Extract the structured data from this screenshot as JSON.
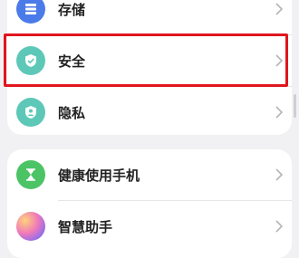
{
  "settings_group_1": {
    "items": [
      {
        "label": "存储",
        "icon": "storage-icon",
        "color": "#4a7be8"
      },
      {
        "label": "安全",
        "icon": "shield-icon",
        "color": "#5ec8b8"
      },
      {
        "label": "隐私",
        "icon": "privacy-icon",
        "color": "#5ec8b8"
      }
    ]
  },
  "settings_group_2": {
    "items": [
      {
        "label": "健康使用手机",
        "icon": "hourglass-icon",
        "color": "#4cc466"
      },
      {
        "label": "智慧助手",
        "icon": "assistant-orb-icon",
        "color": "#c46ad8"
      }
    ]
  },
  "highlight_color": "#e0151d",
  "chevron": "chevron-right-icon"
}
